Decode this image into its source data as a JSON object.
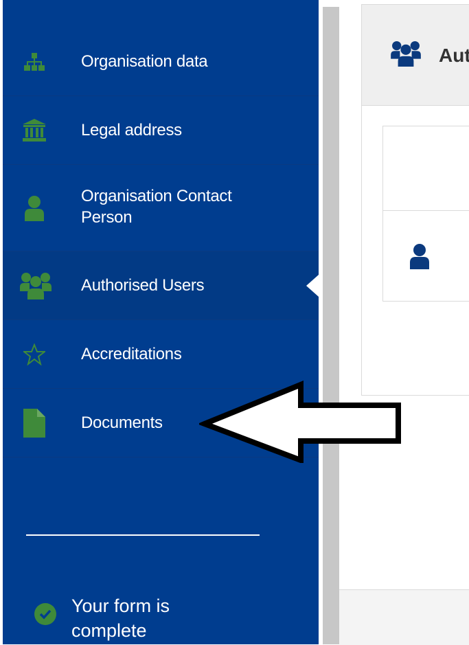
{
  "sidebar": {
    "items": [
      {
        "label": "Organisation data",
        "icon": "org-chart-icon"
      },
      {
        "label": "Legal address",
        "icon": "institution-icon"
      },
      {
        "label": "Organisation Contact Person",
        "icon": "user-icon"
      },
      {
        "label": "Authorised Users",
        "icon": "users-group-icon",
        "active": true
      },
      {
        "label": "Accreditations",
        "icon": "star-outline-icon"
      },
      {
        "label": "Documents",
        "icon": "document-icon"
      }
    ],
    "status": {
      "text": "Your form is complete",
      "icon": "check-circle-icon"
    }
  },
  "content": {
    "panel_title": "Authorised Users"
  },
  "colors": {
    "sidebar_bg": "#003d8f",
    "icon_green": "#3f8a3a",
    "content_icon_blue": "#0b3a7e"
  }
}
